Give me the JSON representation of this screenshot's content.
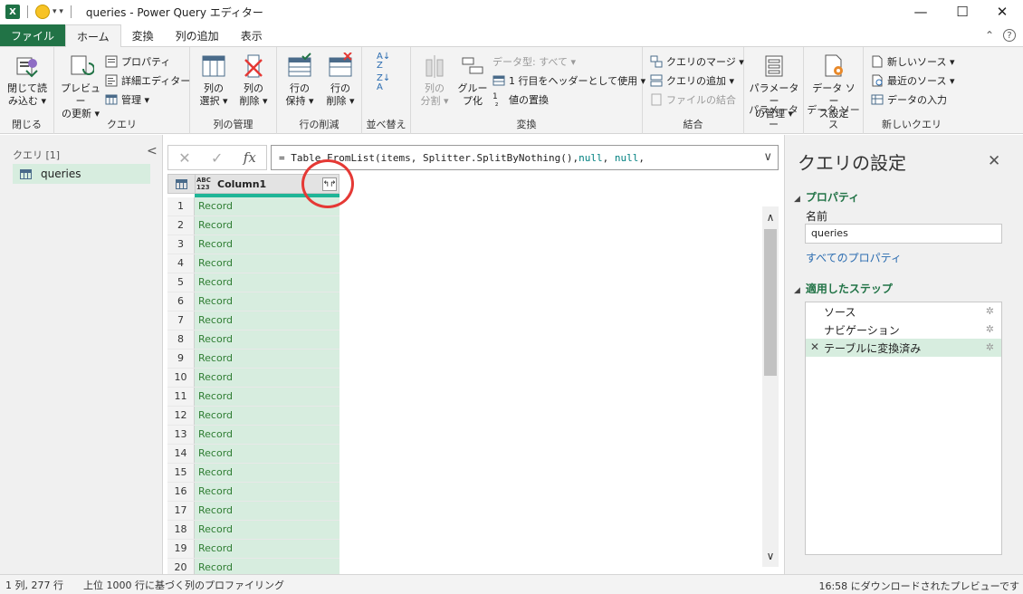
{
  "window": {
    "title": "queries - Power Query エディター",
    "minimize": "—",
    "maximize": "☐",
    "close": "✕"
  },
  "menu_tabs": [
    {
      "label": "ファイル"
    },
    {
      "label": "ホーム"
    },
    {
      "label": "変換"
    },
    {
      "label": "列の追加"
    },
    {
      "label": "表示"
    }
  ],
  "ribbon": {
    "close_group": {
      "label": "閉じる",
      "btn1": "閉じて読",
      "btn2": "み込む ▾"
    },
    "query_group": {
      "label": "クエリ",
      "refresh1": "プレビュー",
      "refresh2": "の更新 ▾",
      "properties": "プロパティ",
      "advanced_editor": "詳細エディター",
      "manage": "管理 ▾"
    },
    "column_mgmt": {
      "label": "列の管理",
      "select1": "列の",
      "select2": "選択 ▾",
      "remove1": "列の",
      "remove2": "削除 ▾"
    },
    "row_reduce": {
      "label": "行の削減",
      "keep1": "行の",
      "keep2": "保持 ▾",
      "remove1": "行の",
      "remove2": "削除 ▾"
    },
    "sort": {
      "label": "並べ替え"
    },
    "transform": {
      "label": "変換",
      "split1": "列の",
      "split2": "分割 ▾",
      "group1": "グルー",
      "group2": "プ化",
      "datatype": "データ型: すべて ▾",
      "use_header": "1 行目をヘッダーとして使用 ▾",
      "replace": "値の置換"
    },
    "combine": {
      "label": "結合",
      "merge": "クエリのマージ ▾",
      "append": "クエリの追加 ▾",
      "combine_files": "ファイルの結合"
    },
    "parameters": {
      "label": "パラメーター",
      "manage1": "パラメーター",
      "manage2": "の管理 ▾"
    },
    "datasource": {
      "label": "データ ソース",
      "settings1": "データ ソー",
      "settings2": "ス設定"
    },
    "newquery": {
      "label": "新しいクエリ",
      "new_source": "新しいソース ▾",
      "recent": "最近のソース ▾",
      "enter_data": "データの入力"
    }
  },
  "left_pane": {
    "header": "クエリ [1]",
    "collapse": "<",
    "items": [
      {
        "label": "queries"
      }
    ]
  },
  "formula": {
    "cancel": "✕",
    "commit": "✓",
    "fx": "fx",
    "prefix": "= Table.FromList(items, Splitter.SplitByNothing(), ",
    "null1": "null",
    "sep": ", ",
    "null2": "null",
    "suffix": ",",
    "expand": "∨"
  },
  "grid": {
    "type_badge_top": "ABC",
    "type_badge_bottom": "123",
    "column_name": "Column1",
    "expand_icon": "↰↱",
    "rows": [
      {
        "n": "1",
        "v": "Record"
      },
      {
        "n": "2",
        "v": "Record"
      },
      {
        "n": "3",
        "v": "Record"
      },
      {
        "n": "4",
        "v": "Record"
      },
      {
        "n": "5",
        "v": "Record"
      },
      {
        "n": "6",
        "v": "Record"
      },
      {
        "n": "7",
        "v": "Record"
      },
      {
        "n": "8",
        "v": "Record"
      },
      {
        "n": "9",
        "v": "Record"
      },
      {
        "n": "10",
        "v": "Record"
      },
      {
        "n": "11",
        "v": "Record"
      },
      {
        "n": "12",
        "v": "Record"
      },
      {
        "n": "13",
        "v": "Record"
      },
      {
        "n": "14",
        "v": "Record"
      },
      {
        "n": "15",
        "v": "Record"
      },
      {
        "n": "16",
        "v": "Record"
      },
      {
        "n": "17",
        "v": "Record"
      },
      {
        "n": "18",
        "v": "Record"
      },
      {
        "n": "19",
        "v": "Record"
      },
      {
        "n": "20",
        "v": "Record"
      }
    ]
  },
  "right_pane": {
    "title": "クエリの設定",
    "close": "✕",
    "properties_header": "プロパティ",
    "name_label": "名前",
    "name_value": "queries",
    "all_properties": "すべてのプロパティ",
    "steps_header": "適用したステップ",
    "steps": [
      {
        "label": "ソース"
      },
      {
        "label": "ナビゲーション"
      },
      {
        "label": "テーブルに変換済み"
      }
    ]
  },
  "status": {
    "left": "1 列, 277 行　　上位 1000 行に基づく列のプロファイリング",
    "right": "16:58 にダウンロードされたプレビューです"
  },
  "colors": {
    "excel_green": "#217346",
    "accent_teal": "#1fb597",
    "highlight_red": "#e53935"
  }
}
